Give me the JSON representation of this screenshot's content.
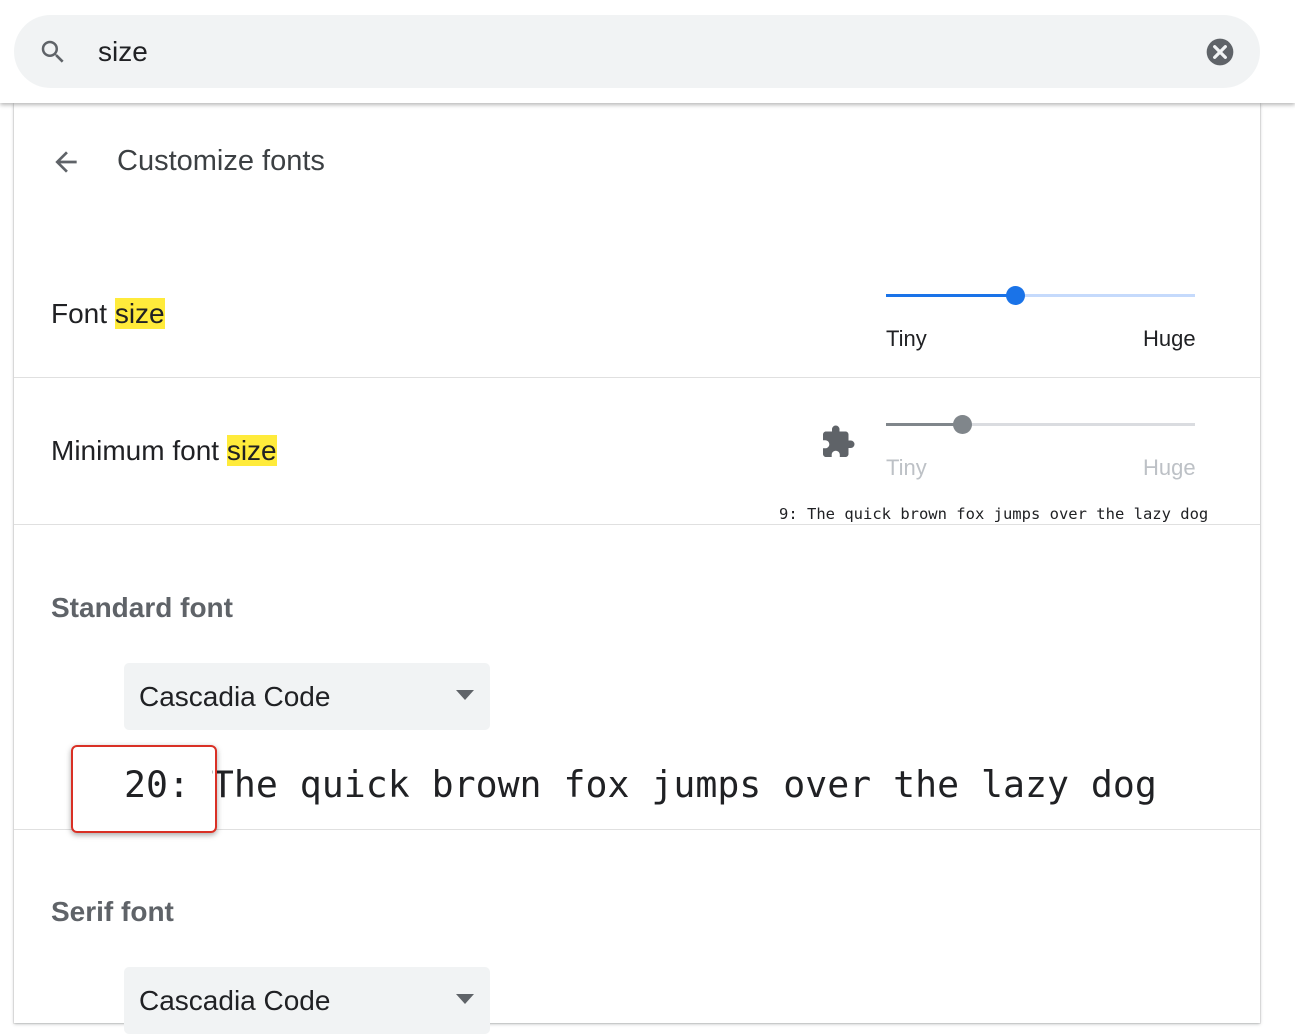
{
  "search": {
    "value": "size"
  },
  "header": {
    "title": "Customize fonts"
  },
  "font_size": {
    "label_prefix": "Font ",
    "label_highlight": "size",
    "min_label": "Tiny",
    "max_label": "Huge",
    "value_fraction": 0.42
  },
  "minimum_font_size": {
    "label_prefix": "Minimum font ",
    "label_highlight": "size",
    "min_label": "Tiny",
    "max_label": "Huge",
    "value_fraction": 0.25,
    "sample": "9: The quick brown fox jumps over the lazy dog",
    "managed_icon": "puzzle-piece-icon"
  },
  "standard_font": {
    "heading": "Standard font",
    "selected": "Cascadia Code",
    "sample": "20: The quick brown fox jumps over the lazy dog"
  },
  "serif_font": {
    "heading": "Serif font",
    "selected": "Cascadia Code"
  },
  "colors": {
    "accent": "#1a73e8",
    "highlight": "#ffeb3b",
    "disabled": "#80868b",
    "focus_ring": "#d93025"
  }
}
